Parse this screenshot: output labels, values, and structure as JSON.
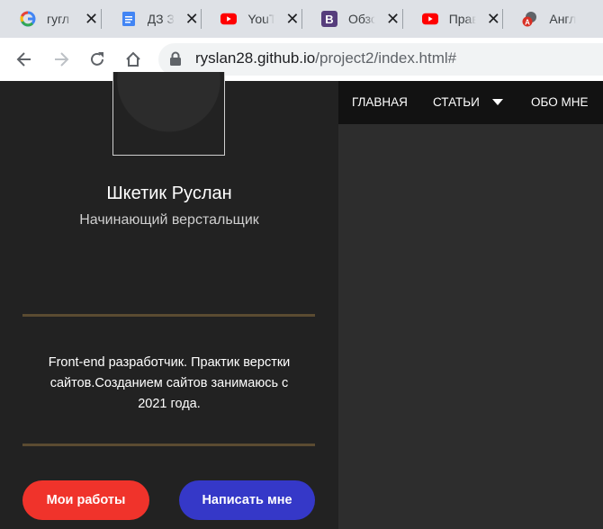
{
  "tabs": [
    {
      "title": "гугл переводчик",
      "icon": "google-icon"
    },
    {
      "title": "ДЗ Задание",
      "icon": "docs-icon"
    },
    {
      "title": "YouTube",
      "icon": "youtube-icon"
    },
    {
      "title": "Обзор",
      "icon": "bootstrap-icon"
    },
    {
      "title": "Правила",
      "icon": "youtube-icon"
    },
    {
      "title": "Английский",
      "icon": "translate-icon"
    }
  ],
  "toolbar": {
    "url_host": "ryslan28.github.io",
    "url_path": "/project2/index.html#"
  },
  "profile": {
    "name": "Шкетик Руслан",
    "role": "Начинающий верстальщик",
    "about": "Front-end разработчик. Практик верстки сайтов.Созданием сайтов занимаюсь с 2021 года.",
    "works_button": "Мои работы",
    "write_button": "Написать мне"
  },
  "nav": {
    "home": "ГЛАВНАЯ",
    "articles": "СТАТЬИ",
    "about": "ОБО МНЕ"
  },
  "colors": {
    "accent_red": "#f0332b",
    "accent_blue": "#3538c8",
    "divider": "#5b4b31"
  }
}
